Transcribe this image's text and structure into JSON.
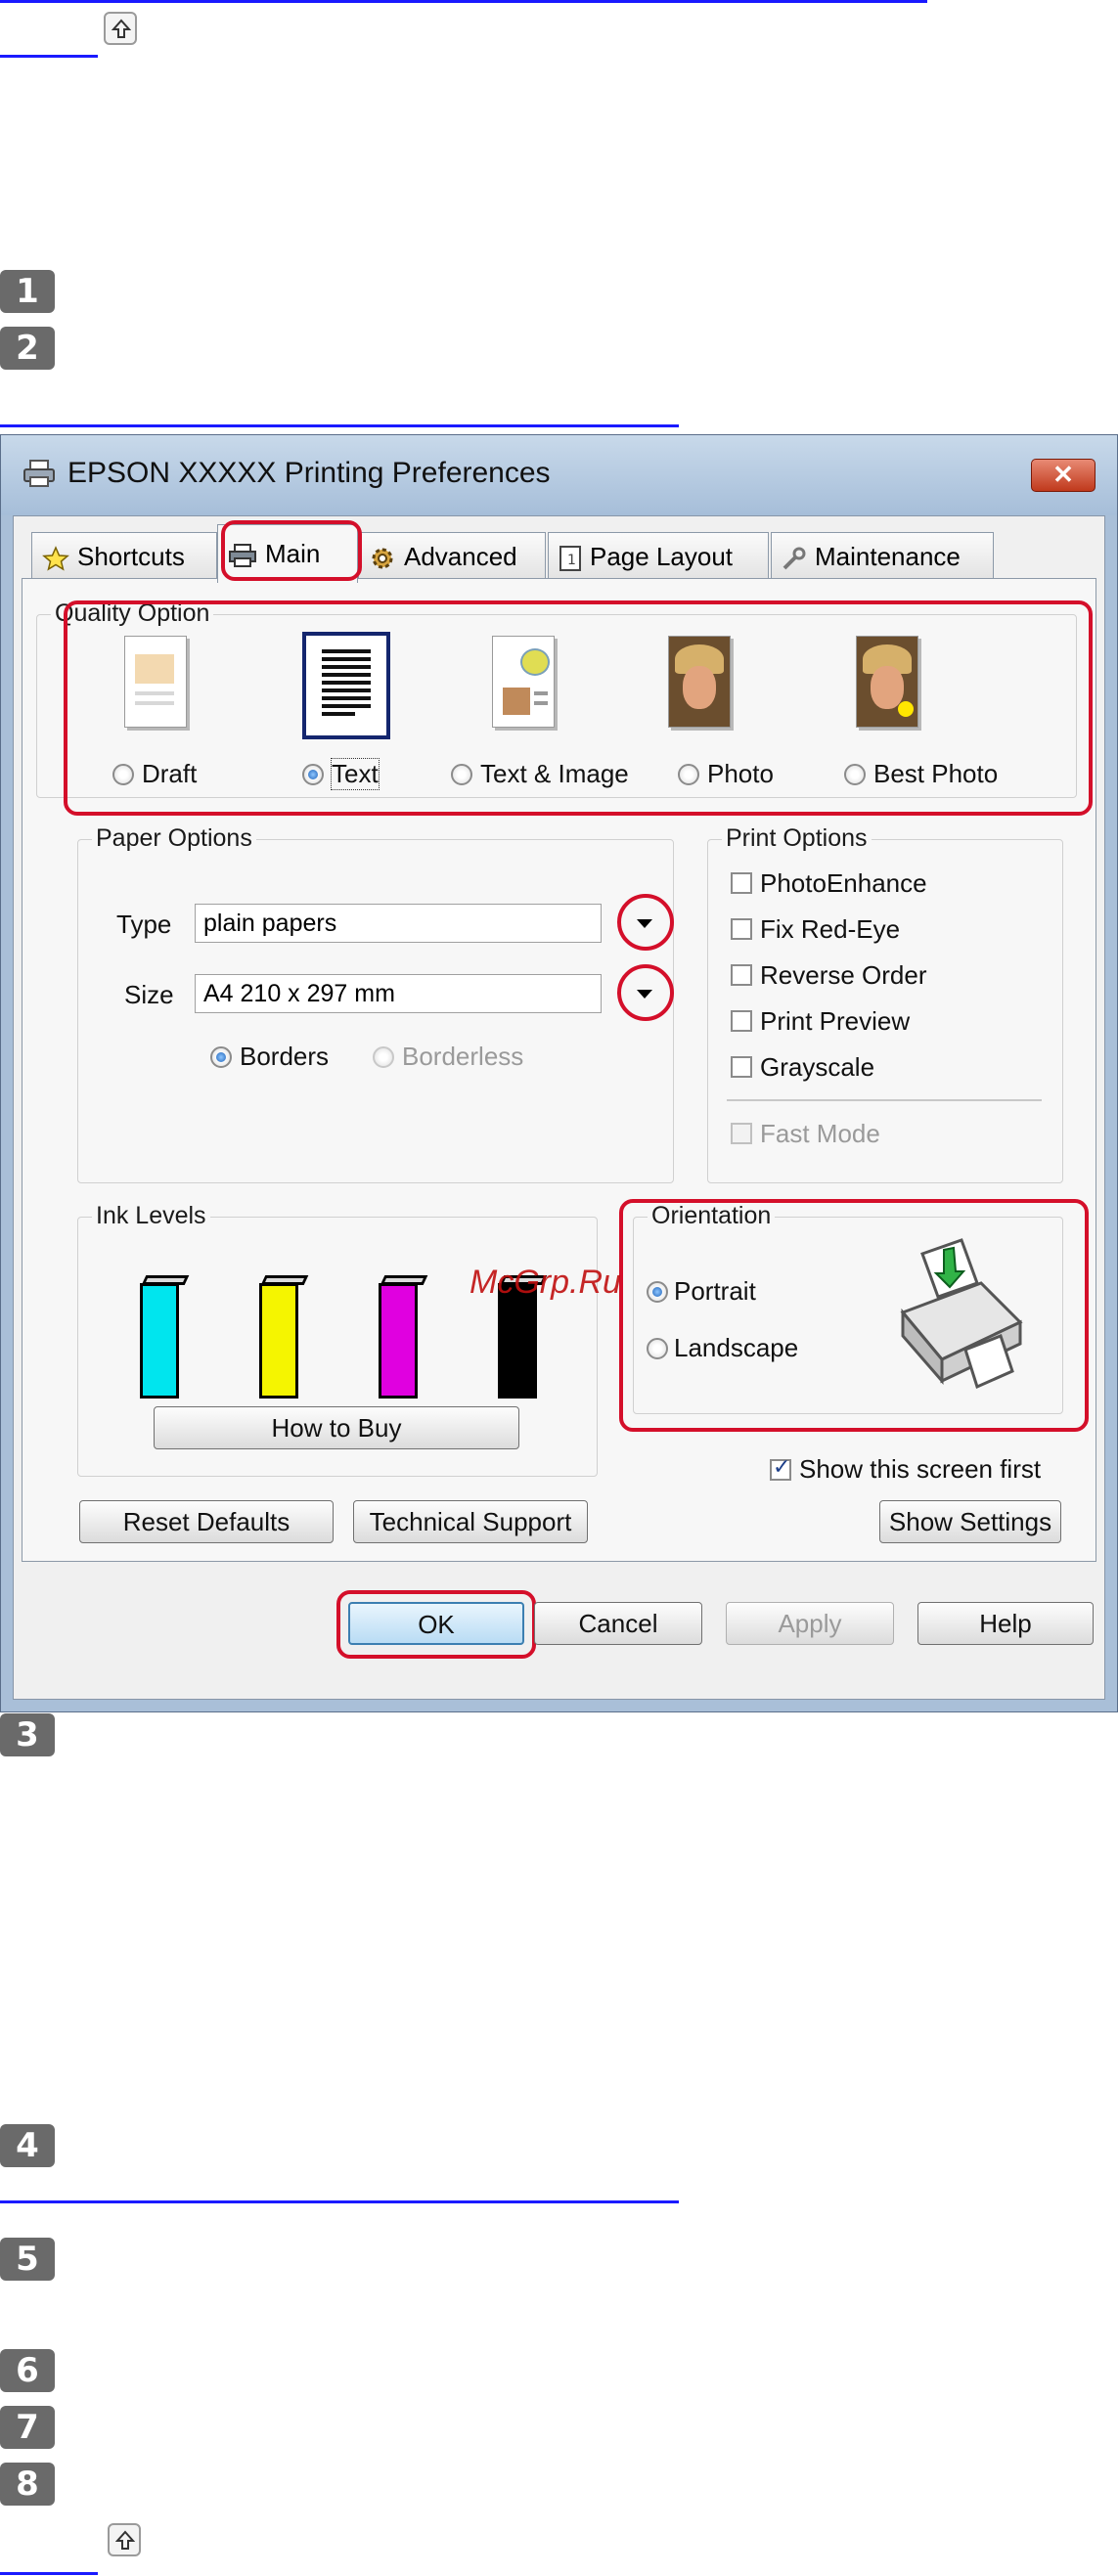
{
  "dialog": {
    "title": "EPSON XXXXX  Printing Preferences",
    "close_label": "✕",
    "tabs": [
      {
        "label": "Shortcuts"
      },
      {
        "label": "Main"
      },
      {
        "label": "Advanced"
      },
      {
        "label": "Page Layout"
      },
      {
        "label": "Maintenance"
      }
    ],
    "quality": {
      "group_label": "Quality Option",
      "options": [
        "Draft",
        "Text",
        "Text & Image",
        "Photo",
        "Best Photo"
      ],
      "selected": "Text"
    },
    "paper": {
      "group_label": "Paper Options",
      "type_label": "Type",
      "type_value": "plain papers",
      "size_label": "Size",
      "size_value": "A4 210 x 297 mm",
      "borders_label": "Borders",
      "borderless_label": "Borderless"
    },
    "print_options": {
      "group_label": "Print Options",
      "items": [
        "PhotoEnhance",
        "Fix Red-Eye",
        "Reverse Order",
        "Print Preview",
        "Grayscale"
      ],
      "fast_mode": "Fast Mode"
    },
    "ink": {
      "group_label": "Ink Levels",
      "colors": [
        "#00e5ee",
        "#f5f500",
        "#e000e0",
        "#000000"
      ],
      "how_to_buy": "How to Buy"
    },
    "orientation": {
      "group_label": "Orientation",
      "portrait": "Portrait",
      "landscape": "Landscape"
    },
    "show_first": "Show this screen first",
    "buttons": {
      "reset": "Reset Defaults",
      "support": "Technical Support",
      "show_settings": "Show Settings",
      "ok": "OK",
      "cancel": "Cancel",
      "apply": "Apply",
      "help": "Help"
    }
  },
  "steps": [
    "1",
    "2",
    "3",
    "4",
    "5",
    "6",
    "7",
    "8"
  ],
  "watermark": "McGrp.Ru",
  "accent_red": "#d40f2a"
}
